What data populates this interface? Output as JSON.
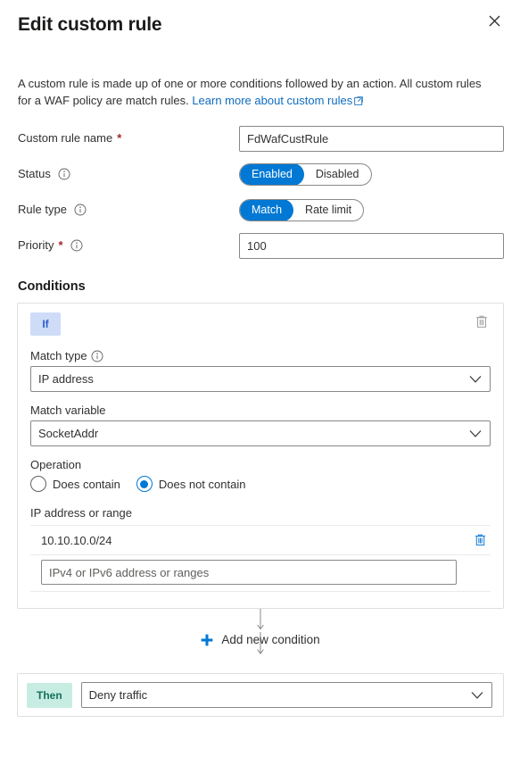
{
  "header": {
    "title": "Edit custom rule",
    "close_label": "✕"
  },
  "intro": {
    "text_before": "A custom rule is made up of one or more conditions followed by an action. All custom rules for a WAF policy are match rules. ",
    "link_text": "Learn more about custom rules",
    "external_icon": "external-link-icon"
  },
  "form": {
    "rule_name": {
      "label": "Custom rule name",
      "required": "*",
      "value": "FdWafCustRule",
      "placeholder": ""
    },
    "status": {
      "label": "Status",
      "info": "info-icon",
      "options": [
        "Enabled",
        "Disabled"
      ],
      "selected": "Enabled"
    },
    "rule_type": {
      "label": "Rule type",
      "info": "info-icon",
      "options": [
        "Match",
        "Rate limit"
      ],
      "selected": "Match"
    },
    "priority": {
      "label": "Priority",
      "required": "*",
      "info": "info-icon",
      "value": "100",
      "placeholder": ""
    }
  },
  "conditions": {
    "section_title": "Conditions",
    "if_badge": "If",
    "delete_condition_icon": "trash-icon",
    "match_type": {
      "label": "Match type",
      "info": "info-icon",
      "value": "IP address",
      "chevron": "chevron-down-icon"
    },
    "match_variable": {
      "label": "Match variable",
      "value": "SocketAddr",
      "chevron": "chevron-down-icon"
    },
    "operation": {
      "label": "Operation",
      "options": [
        "Does contain",
        "Does not contain"
      ],
      "selected": "Does not contain"
    },
    "ip_list": {
      "label": "IP address or range",
      "rows": [
        "10.10.10.0/24"
      ],
      "row_delete_icon": "trash-icon",
      "new_entry_placeholder": "IPv4 or IPv6 address or ranges",
      "new_entry_value": ""
    }
  },
  "add_condition": {
    "label": "Add new condition",
    "icon": "plus-icon"
  },
  "then": {
    "badge": "Then",
    "action_value": "Deny traffic",
    "chevron": "chevron-down-icon"
  },
  "colors": {
    "accent_blue": "#0078d4",
    "link_blue": "#0f6cbd",
    "if_badge_bg": "#cfdcf7",
    "if_badge_text": "#2b5fc9",
    "then_badge_bg": "#c7ede2",
    "then_badge_text": "#13705c",
    "required_red": "#a4262c",
    "border_gray": "#8a8886"
  }
}
